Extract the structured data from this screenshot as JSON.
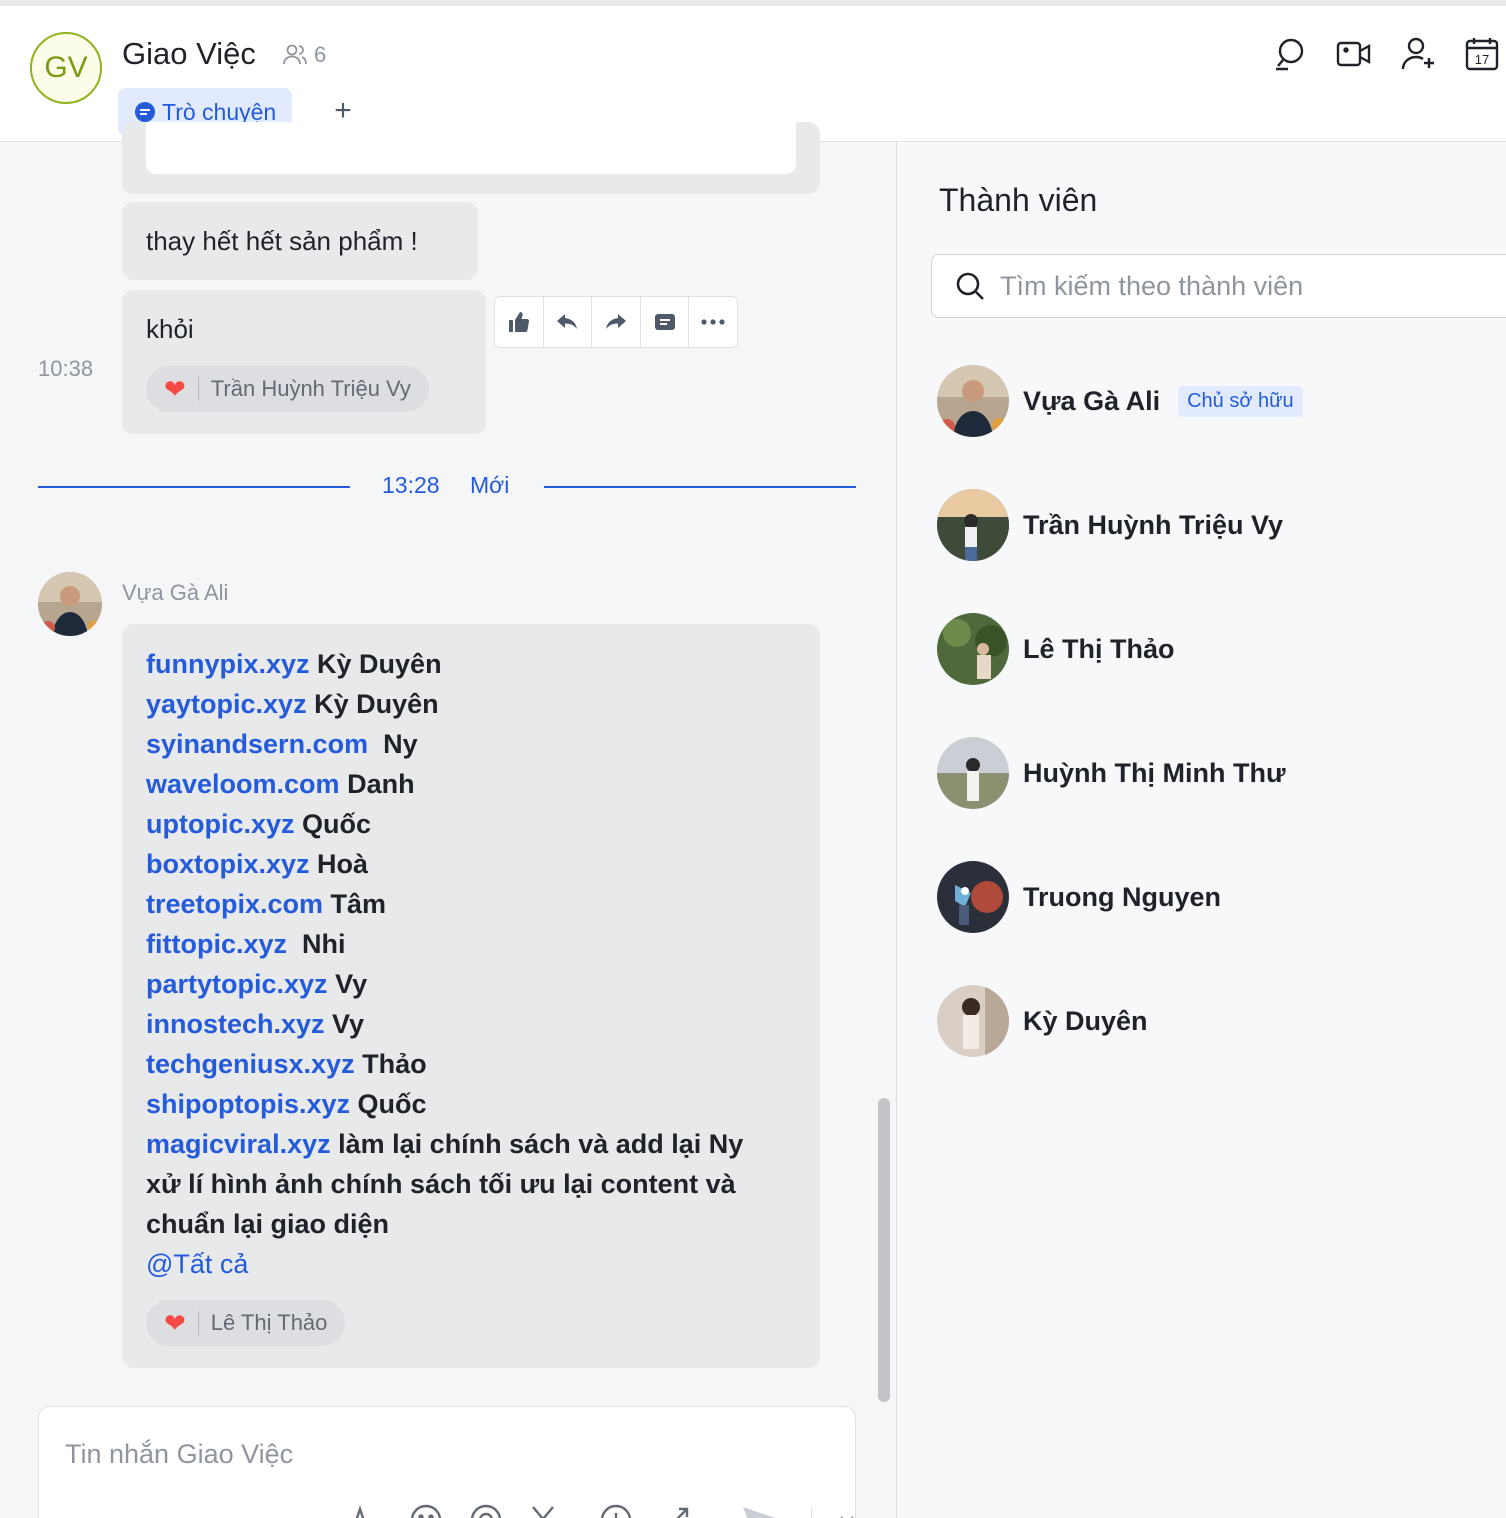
{
  "header": {
    "avatar_initials": "GV",
    "group_name": "Giao Việc",
    "member_count": "6",
    "tab_chat_label": "Trò chuyện",
    "tab_add_label": "+"
  },
  "messages": {
    "msg1": "thay hết hết sản phẩm !",
    "msg2": "khỏi",
    "msg2_time": "10:38",
    "msg2_reaction_user": "Trần Huỳnh Triệu Vy",
    "divider_time": "13:28",
    "divider_label": "Mới",
    "sender_name": "Vựa Gà Ali",
    "lines": [
      {
        "link": "funnypix.xyz",
        "text": " Kỳ Duyên"
      },
      {
        "link": "yaytopic.xyz",
        "text": " Kỳ Duyên"
      },
      {
        "link": "syinandsern.com",
        "text": "  Ny"
      },
      {
        "link": "waveloom.com",
        "text": " Danh"
      },
      {
        "link": "uptopic.xyz",
        "text": " Quốc"
      },
      {
        "link": "boxtopix.xyz",
        "text": " Hoà"
      },
      {
        "link": "treetopix.com",
        "text": " Tâm"
      },
      {
        "link": "fittopic.xyz",
        "text": "  Nhi"
      },
      {
        "link": "partytopic.xyz",
        "text": " Vy"
      },
      {
        "link": "innostech.xyz",
        "text": " Vy"
      },
      {
        "link": "techgeniusx.xyz",
        "text": " Thảo"
      },
      {
        "link": "shipoptopis.xyz",
        "text": " Quốc"
      },
      {
        "link": "magicviral.xyz",
        "text": " làm lại chính sách và add lại Ny"
      }
    ],
    "tail1": "xử lí hình ảnh chính sách tối ưu lại content và",
    "tail2": "chuẩn lại giao diện",
    "mention": "@Tất cả",
    "msg3_reaction_user": "Lê Thị Thảo"
  },
  "composer": {
    "placeholder": "Tin nhắn Giao Việc"
  },
  "sidebar": {
    "title": "Thành viên",
    "search_placeholder": "Tìm kiếm theo thành viên",
    "owner_badge": "Chủ sở hữu",
    "members": [
      {
        "name": "Vựa Gà Ali"
      },
      {
        "name": "Trần Huỳnh Triệu Vy"
      },
      {
        "name": "Lê Thị Thảo"
      },
      {
        "name": "Huỳnh Thị Minh Thư"
      },
      {
        "name": "Truong Nguyen"
      },
      {
        "name": "Kỳ Duyên"
      }
    ]
  },
  "colors": {
    "accent": "#245bdb",
    "group_avatar": "#8fb21f",
    "reaction_heart": "#f54a45"
  },
  "icons": {
    "header": [
      "search-icon",
      "video-icon",
      "add-member-icon",
      "calendar-icon"
    ],
    "toolbar": [
      "thumbs-up-icon",
      "reply-icon",
      "forward-icon",
      "quote-icon",
      "more-icon"
    ]
  }
}
